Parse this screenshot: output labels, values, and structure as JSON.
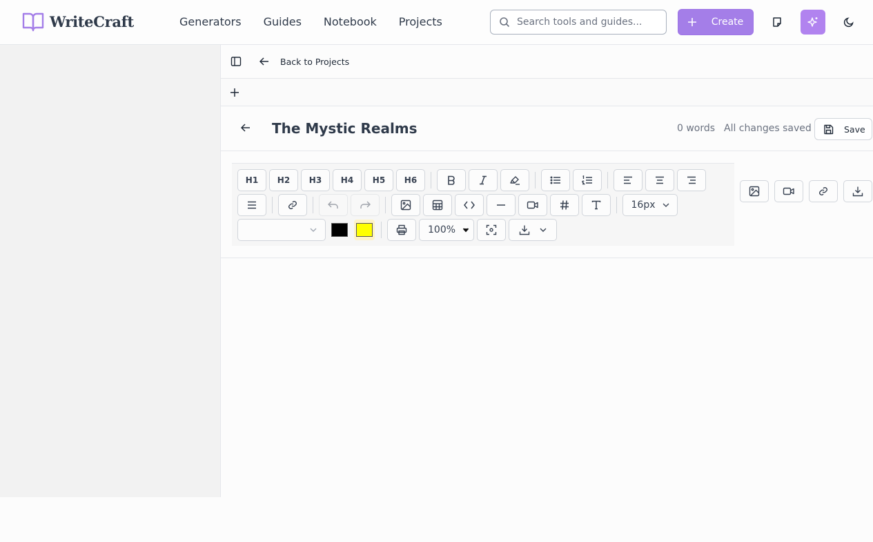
{
  "app": {
    "name": "WriteCraft"
  },
  "nav": {
    "items": [
      "Generators",
      "Guides",
      "Notebook",
      "Projects"
    ]
  },
  "search": {
    "placeholder": "Search tools and guides..."
  },
  "header": {
    "create_label": "Create"
  },
  "breadcrumb": {
    "back_label": "Back to Projects"
  },
  "document": {
    "title": "The Mystic Realms",
    "word_count": "0 words",
    "save_status": "All changes saved",
    "save_label": "Save"
  },
  "toolbar": {
    "headings": [
      "H1",
      "H2",
      "H3",
      "H4",
      "H5",
      "H6"
    ],
    "font_size": "16px",
    "font_family": "",
    "text_color": "#000000",
    "highlight_color": "#ffff00",
    "zoom": "100%"
  },
  "colors": {
    "accent": "#a47ee8",
    "ai_button": "#b183ef"
  }
}
